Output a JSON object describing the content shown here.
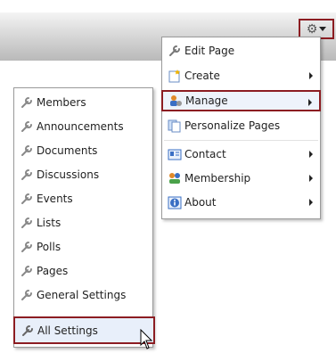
{
  "toolbar": {
    "gear_icon": "gear-icon"
  },
  "manage_menu": {
    "items": [
      {
        "label": "Edit Page",
        "icon": "wrench-icon",
        "submenu": false
      },
      {
        "label": "Create",
        "icon": "create-icon",
        "submenu": true
      },
      {
        "label": "Manage",
        "icon": "manage-icon",
        "submenu": true
      },
      {
        "label": "Personalize Pages",
        "icon": "personalize-icon",
        "submenu": false
      },
      {
        "label": "Contact",
        "icon": "contact-icon",
        "submenu": true
      },
      {
        "label": "Membership",
        "icon": "membership-icon",
        "submenu": true
      },
      {
        "label": "About",
        "icon": "about-icon",
        "submenu": true
      }
    ]
  },
  "settings_menu": {
    "items": [
      {
        "label": "Members"
      },
      {
        "label": "Announcements"
      },
      {
        "label": "Documents"
      },
      {
        "label": "Discussions"
      },
      {
        "label": "Events"
      },
      {
        "label": "Lists"
      },
      {
        "label": "Polls"
      },
      {
        "label": "Pages"
      },
      {
        "label": "General Settings"
      },
      {
        "label": "All Settings"
      }
    ]
  },
  "colors": {
    "highlight_border": "#8c1d22",
    "menu_border": "#9a9a9a"
  }
}
